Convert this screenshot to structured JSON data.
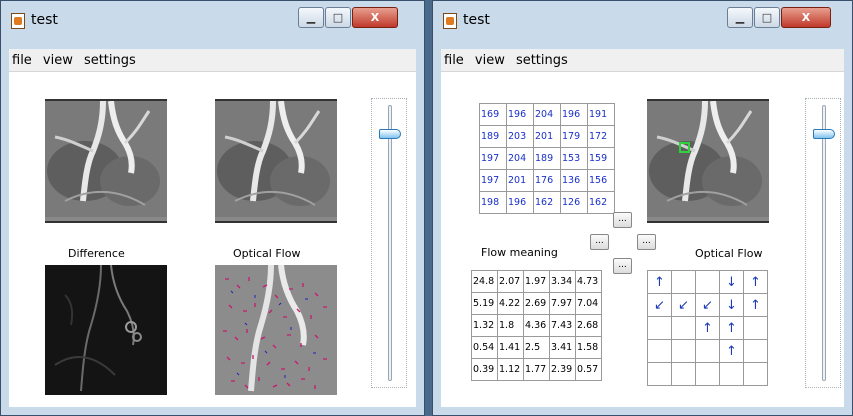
{
  "left_window": {
    "title": "test",
    "controls": {
      "minimize": "▁",
      "maximize": "□",
      "close": "X"
    },
    "menu": [
      "file",
      "view",
      "settings"
    ],
    "captions": {
      "difference": "Difference",
      "optical_flow": "Optical Flow"
    }
  },
  "right_window": {
    "title": "test",
    "controls": {
      "minimize": "▁",
      "maximize": "□",
      "close": "X"
    },
    "menu": [
      "file",
      "view",
      "settings"
    ],
    "captions": {
      "flow_meaning": "Flow meaning",
      "optical_flow": "Optical Flow"
    },
    "button_label": "...",
    "intensity_grid": [
      [
        "169",
        "196",
        "204",
        "196",
        "191"
      ],
      [
        "189",
        "203",
        "201",
        "179",
        "172"
      ],
      [
        "197",
        "204",
        "189",
        "153",
        "159"
      ],
      [
        "197",
        "201",
        "176",
        "136",
        "156"
      ],
      [
        "198",
        "196",
        "162",
        "126",
        "162"
      ]
    ],
    "flow_grid": [
      [
        "24.8",
        "2.07",
        "1.97",
        "3.34",
        "4.73"
      ],
      [
        "5.19",
        "4.22",
        "2.69",
        "7.97",
        "7.04"
      ],
      [
        "1.32",
        "1.8",
        "4.36",
        "7.43",
        "2.68"
      ],
      [
        "0.54",
        "1.41",
        "2.5",
        "3.41",
        "1.58"
      ],
      [
        "0.39",
        "1.12",
        "1.77",
        "2.39",
        "0.57"
      ]
    ],
    "arrow_grid": [
      [
        "↑",
        "",
        "",
        "↓",
        "↑"
      ],
      [
        "↙",
        "↙",
        "↙",
        "↓",
        "↑"
      ],
      [
        "",
        "",
        "↑",
        "↑",
        ""
      ],
      [
        "",
        "",
        "",
        "↑",
        ""
      ],
      [
        "",
        "",
        "",
        "",
        ""
      ]
    ]
  }
}
